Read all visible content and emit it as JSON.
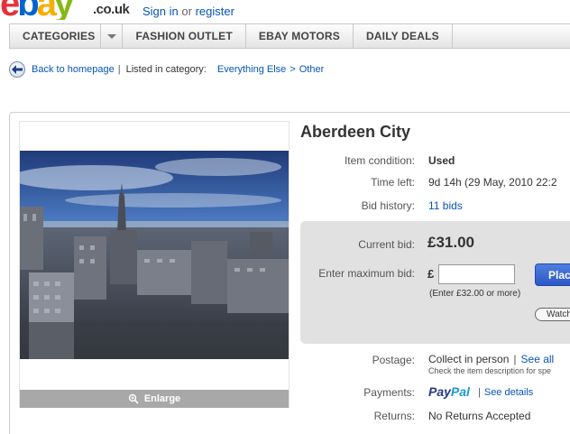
{
  "header": {
    "logo_letters": [
      "e",
      "b",
      "a",
      "y"
    ],
    "tld": ".co.uk",
    "signin_label": "Sign in",
    "or_text": "or",
    "register_label": "register"
  },
  "nav": {
    "categories": "CATEGORIES",
    "fashion_outlet": "FASHION OUTLET",
    "ebay_motors": "EBAY MOTORS",
    "daily_deals": "DAILY DEALS"
  },
  "breadcrumb": {
    "back_label": "Back to homepage",
    "sep": "|",
    "listed_in": "Listed in category:",
    "cat1": "Everything Else",
    "gt": ">",
    "cat2": "Other"
  },
  "listing": {
    "title": "Aberdeen City",
    "enlarge_label": "Enlarge",
    "condition_label": "Item condition:",
    "condition_value": "Used",
    "time_left_label": "Time left:",
    "time_left_value": "9d 14h (29 May, 2010 22:2",
    "bid_history_label": "Bid history:",
    "bid_history_value": "11 bids"
  },
  "bidding": {
    "current_bid_label": "Current bid:",
    "current_bid_value": "£31.00",
    "max_bid_label": "Enter maximum bid:",
    "currency_symbol": "£",
    "input_value": "",
    "place_label": "Plac",
    "hint": "(Enter £32.00 or more)",
    "watch_label": "Watch"
  },
  "shipping": {
    "postage_label": "Postage:",
    "postage_value": "Collect in person",
    "pipe": "|",
    "see_all": "See all",
    "postage_sub": "Check the item description for spe",
    "payments_label": "Payments:",
    "paypal_pay": "Pay",
    "paypal_pal": "Pal",
    "see_details": "See details",
    "returns_label": "Returns:",
    "returns_value": "No Returns Accepted"
  },
  "colors": {
    "link": "#0654ba",
    "ebay_red": "#e53238",
    "ebay_blue": "#0064d2",
    "ebay_yellow": "#f5af02",
    "ebay_green": "#86b817",
    "bid_box": "#e1e1e1",
    "place_bid_button": "#2b57c6"
  },
  "icons": {
    "back": "back-arrow-icon",
    "enlarge": "magnifier-icon",
    "nav_dropdown": "chevron-down-icon"
  }
}
